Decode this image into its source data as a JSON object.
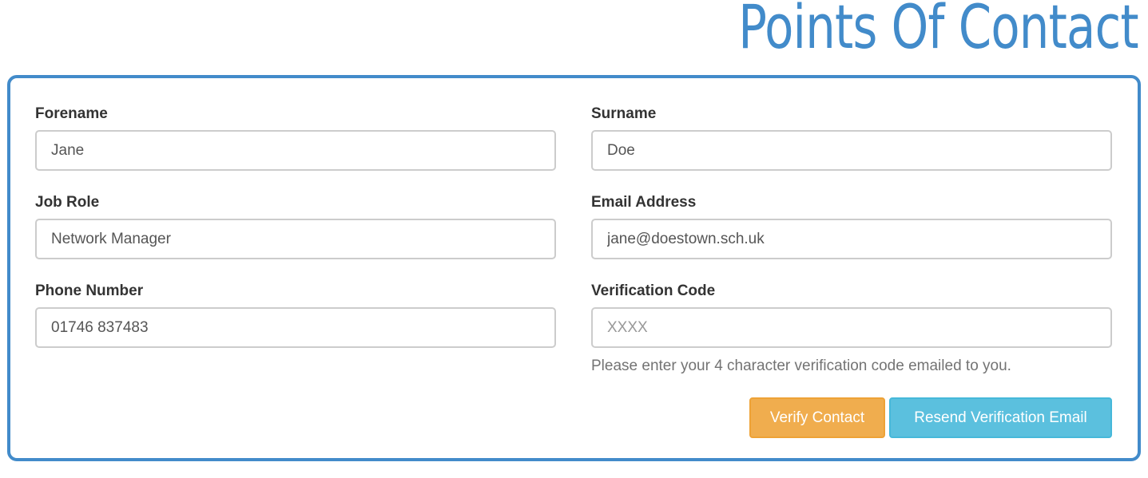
{
  "page": {
    "title": "Points Of Contact"
  },
  "form": {
    "forename": {
      "label": "Forename",
      "value": "Jane"
    },
    "surname": {
      "label": "Surname",
      "value": "Doe"
    },
    "job_role": {
      "label": "Job Role",
      "value": "Network Manager"
    },
    "email": {
      "label": "Email Address",
      "value": "jane@doestown.sch.uk"
    },
    "phone": {
      "label": "Phone Number",
      "value": "01746 837483"
    },
    "verification_code": {
      "label": "Verification Code",
      "value": "",
      "placeholder": "XXXX",
      "help": "Please enter your 4 character verification code emailed to you."
    }
  },
  "actions": {
    "verify_label": "Verify Contact",
    "resend_label": "Resend Verification Email"
  },
  "colors": {
    "accent": "#428bca",
    "verify_button": "#f0ad4e",
    "resend_button": "#5bc0de"
  }
}
